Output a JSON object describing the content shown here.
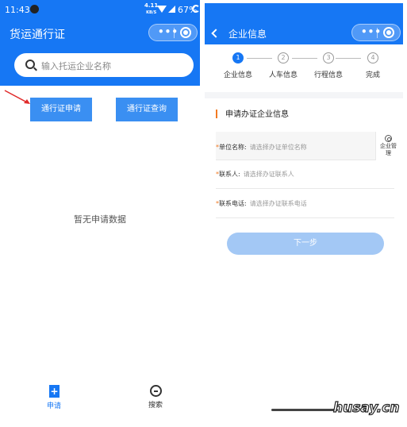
{
  "left_screen": {
    "status_bar": {
      "time": "11:43",
      "speed_top": "4.11",
      "speed_unit": "KB/S",
      "battery": "67%"
    },
    "header_title": "货运通行证",
    "search_placeholder": "输入托运企业名称",
    "buttons": {
      "apply": "通行证申请",
      "query": "通行证查询"
    },
    "empty_text": "暂无申请数据",
    "tabbar": [
      {
        "label": "申请",
        "icon": "document-plus-icon",
        "active": true
      },
      {
        "label": "搜索",
        "icon": "search-chat-icon",
        "active": false
      }
    ],
    "accent_color": "#1677f4"
  },
  "right_screen": {
    "header_title": "企业信息",
    "steps": [
      {
        "number": "1",
        "label": "企业信息",
        "active": true
      },
      {
        "number": "2",
        "label": "人车信息",
        "active": false
      },
      {
        "number": "3",
        "label": "行程信息",
        "active": false
      },
      {
        "number": "4",
        "label": "完成",
        "active": false
      }
    ],
    "section_title": "申请办证企业信息",
    "fields": [
      {
        "required_mark": "*",
        "label": "单位名称:",
        "placeholder": "请选择办证单位名称"
      },
      {
        "required_mark": "*",
        "label": "联系人:",
        "placeholder": "请选择办证联系人"
      },
      {
        "required_mark": "*",
        "label": "联系电话:",
        "placeholder": "请选择办证联系电话"
      }
    ],
    "manage_label": "企业管理",
    "next_button": "下一步",
    "section_mark_color": "#f27a22"
  },
  "watermark": "husay.cn"
}
